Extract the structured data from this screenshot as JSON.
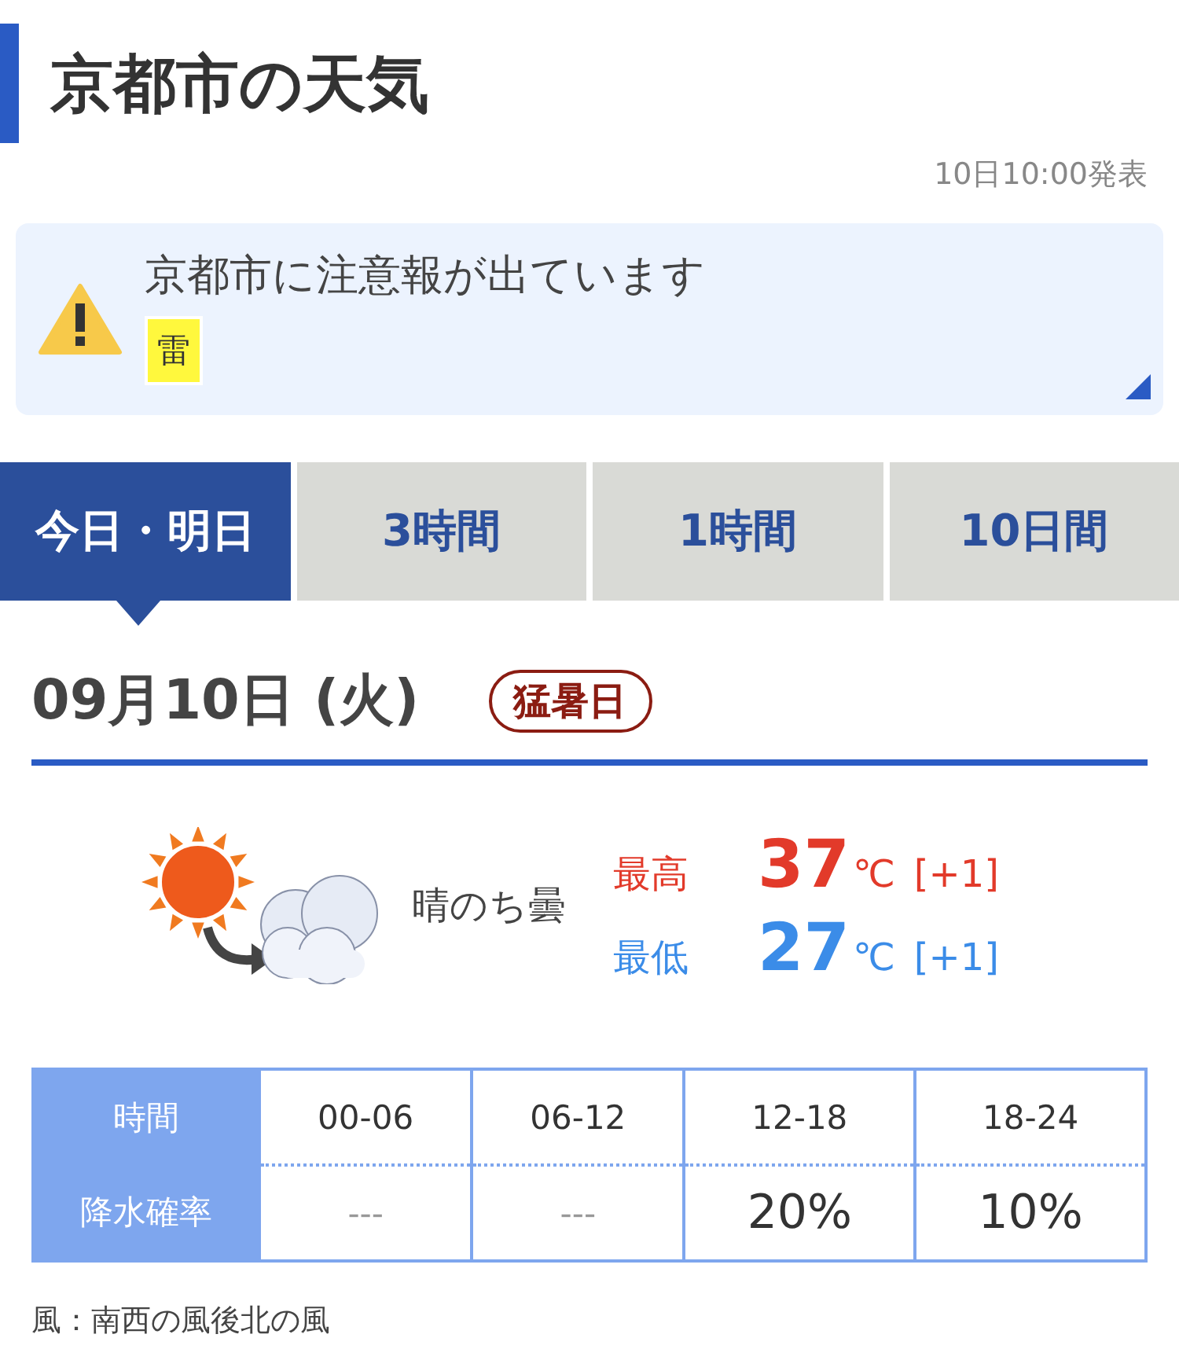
{
  "page": {
    "title": "京都市の天気",
    "published": "10日10:00発表"
  },
  "alert": {
    "message": "京都市に注意報が出ています",
    "warnings": [
      "雷"
    ]
  },
  "tabs": [
    {
      "label": "今日・明日",
      "selected": true
    },
    {
      "label": "3時間",
      "selected": false
    },
    {
      "label": "1時間",
      "selected": false
    },
    {
      "label": "10日間",
      "selected": false
    }
  ],
  "day": {
    "date": "09月10日 (火)",
    "badge": "猛暑日",
    "weather": "晴のち曇",
    "temperatures": [
      {
        "kind": "high",
        "label": "最高",
        "value": "37",
        "unit": "℃",
        "diff": "[+1]"
      },
      {
        "kind": "low",
        "label": "最低",
        "value": "27",
        "unit": "℃",
        "diff": "[+1]"
      }
    ]
  },
  "table": {
    "rows": [
      {
        "kind": "time",
        "label": "時間",
        "cells": [
          {
            "text": "00-06",
            "muted": false
          },
          {
            "text": "06-12",
            "muted": false
          },
          {
            "text": "12-18",
            "muted": false
          },
          {
            "text": "18-24",
            "muted": false
          }
        ]
      },
      {
        "kind": "precip",
        "label": "降水確率",
        "cells": [
          {
            "text": "---",
            "muted": true
          },
          {
            "text": "---",
            "muted": true
          },
          {
            "text": "20%",
            "muted": false
          },
          {
            "text": "10%",
            "muted": false
          }
        ]
      }
    ]
  },
  "wind": "風：南西の風後北の風"
}
